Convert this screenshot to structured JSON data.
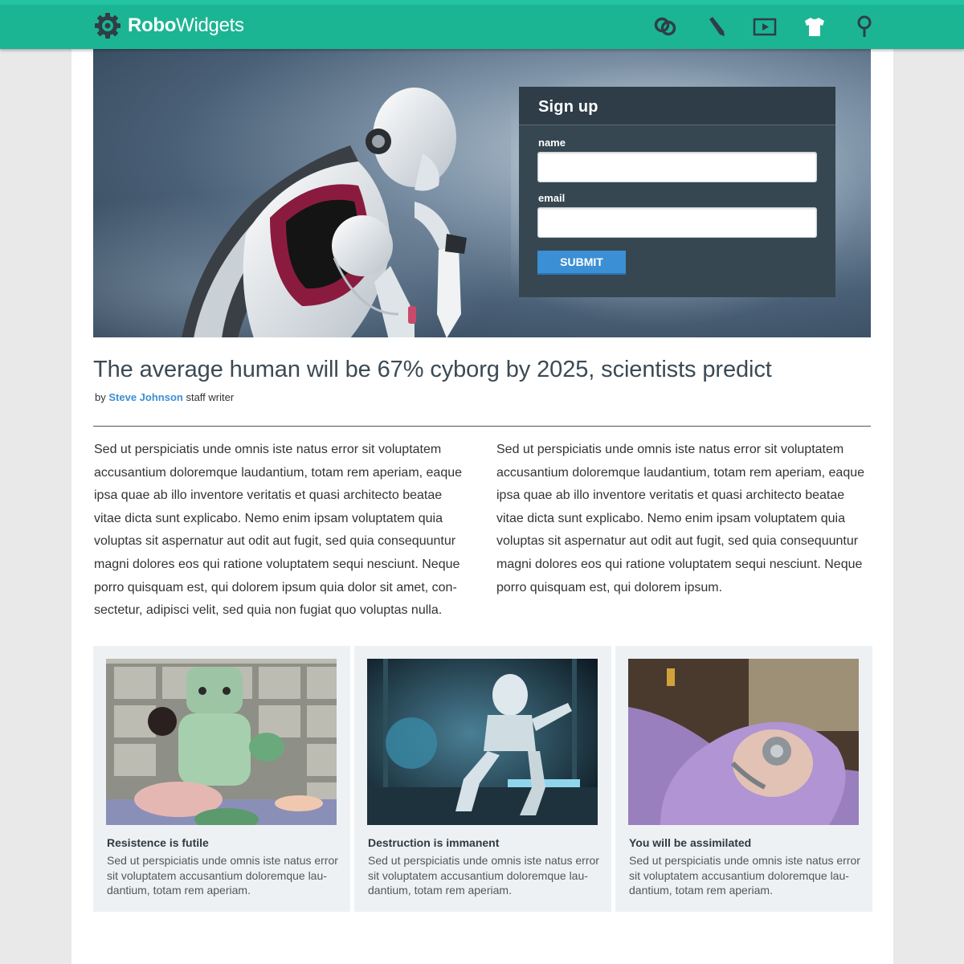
{
  "brand": {
    "name_bold": "Robo",
    "name_light": "Widgets",
    "primary_color": "#1bb593",
    "accent_color": "#3b8fd4"
  },
  "nav": [
    {
      "icon": "link-icon"
    },
    {
      "icon": "pencil-icon"
    },
    {
      "icon": "video-icon"
    },
    {
      "icon": "tshirt-icon"
    },
    {
      "icon": "location-pin-icon"
    }
  ],
  "signup": {
    "title": "Sign up",
    "name_label": "name",
    "name_value": "",
    "email_label": "email",
    "email_value": "",
    "submit_label": "SUBMIT"
  },
  "article": {
    "headline": "The average human will be 67% cyborg by 2025, scientists predict",
    "byline_prefix": "by",
    "author": "Steve Johnson",
    "author_role": "staff writer",
    "col_left": "Sed ut perspiciatis unde omnis iste natus error sit voluptatem accusantium doloremque laudantium, totam rem aperiam, eaque ipsa quae ab illo inventore veritatis et quasi architecto beatae vitae dicta sunt explicabo. Nemo enim ipsam voluptatem quia voluptas sit aspernatur aut odit aut fugit, sed quia consequuntur magni dolores eos qui ratione voluptatem sequi nesciunt. Neque porro quisquam est, qui dolorem ipsum quia dolor sit amet, con-sectetur, adipisci velit, sed quia non fugiat quo voluptas nulla.",
    "col_right": "Sed ut perspiciatis unde omnis iste natus error sit voluptatem accusantium doloremque laudantium, totam rem aperiam, eaque ipsa quae ab illo inventore veritatis et quasi architecto beatae vitae dicta sunt explicabo. Nemo enim ipsam voluptatem quia voluptas sit aspernatur aut odit aut fugit, sed quia consequuntur magni dolores eos qui ratione voluptatem sequi nesciunt. Neque porro quisquam est, qui dolorem ipsum."
  },
  "cards": [
    {
      "title": "Resistence is futile",
      "text": "Sed ut perspiciatis unde omnis iste natus error sit voluptatem accusantium doloremque lau-dantium, totam rem aperiam."
    },
    {
      "title": "Destruction is immanent",
      "text": "Sed ut perspiciatis unde omnis iste natus error sit voluptatem accusantium doloremque lau-dantium, totam rem aperiam."
    },
    {
      "title": "You will be assimilated",
      "text": "Sed ut perspiciatis unde omnis iste natus error sit voluptatem accusantium doloremque lau-dantium, totam rem aperiam."
    }
  ]
}
